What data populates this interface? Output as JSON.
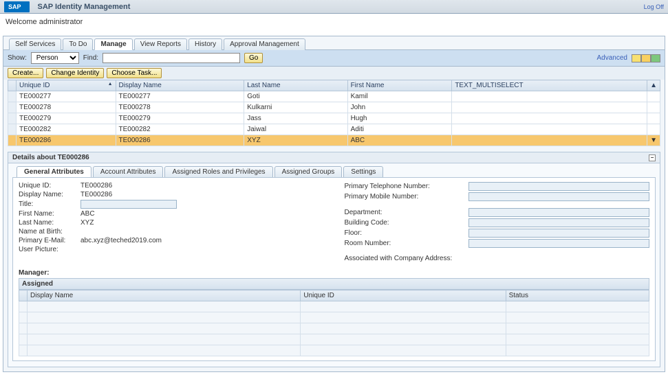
{
  "header": {
    "logo_text": "SAP",
    "app_title": "SAP Identity Management",
    "log_off": "Log Off"
  },
  "welcome": "Welcome administrator",
  "tabs": {
    "items": [
      "Self Services",
      "To Do",
      "Manage",
      "View Reports",
      "History",
      "Approval Management"
    ],
    "active_index": 2
  },
  "filter": {
    "show_label": "Show:",
    "show_value": "Person",
    "find_label": "Find:",
    "go_label": "Go",
    "advanced_label": "Advanced"
  },
  "toolbar_buttons": [
    "Create...",
    "Change Identity",
    "Choose Task..."
  ],
  "grid": {
    "columns": [
      "Unique ID",
      "Display Name",
      "Last Name",
      "First Name",
      "TEXT_MULTISELECT"
    ],
    "rows": [
      {
        "uid": "TE000277",
        "display": "TE000277",
        "last": "Goti",
        "first": "Kamil",
        "txt": ""
      },
      {
        "uid": "TE000278",
        "display": "TE000278",
        "last": "Kulkarni",
        "first": "John",
        "txt": ""
      },
      {
        "uid": "TE000279",
        "display": "TE000279",
        "last": "Jass",
        "first": "Hugh",
        "txt": ""
      },
      {
        "uid": "TE000282",
        "display": "TE000282",
        "last": "Jaiwal",
        "first": "Aditi",
        "txt": ""
      },
      {
        "uid": "TE000286",
        "display": "TE000286",
        "last": "XYZ",
        "first": "ABC",
        "txt": ""
      }
    ],
    "selected_index": 4
  },
  "details": {
    "title": "Details about TE000286",
    "tabs": [
      "General Attributes",
      "Account Attributes",
      "Assigned Roles and Privileges",
      "Assigned Groups",
      "Settings"
    ],
    "active_tab": 0,
    "form": {
      "unique_id_label": "Unique ID:",
      "unique_id": "TE000286",
      "display_name_label": "Display Name:",
      "display_name": "TE000286",
      "title_label": "Title:",
      "title": "",
      "first_name_label": "First Name:",
      "first_name": "ABC",
      "last_name_label": "Last Name:",
      "last_name": "XYZ",
      "name_at_birth_label": "Name at Birth:",
      "email_label": "Primary E-Mail:",
      "email": "abc.xyz@teched2019.com",
      "user_picture_label": "User Picture:",
      "phone_label": "Primary Telephone Number:",
      "mobile_label": "Primary Mobile Number:",
      "dept_label": "Department:",
      "building_label": "Building Code:",
      "floor_label": "Floor:",
      "room_label": "Room Number:",
      "assoc_label": "Associated with Company Address:"
    },
    "manager_label": "Manager:",
    "assigned_label": "Assigned",
    "assigned_cols": [
      "Display Name",
      "Unique ID",
      "Status"
    ]
  }
}
